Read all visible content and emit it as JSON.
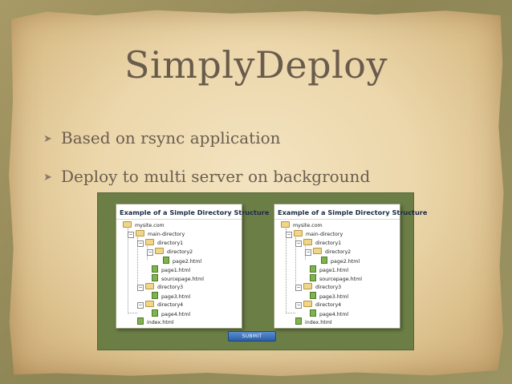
{
  "slide": {
    "title": "SimplyDeploy",
    "bullets": [
      {
        "icon": "arrow-bullet-icon",
        "text": "Based on rsync application"
      },
      {
        "icon": "arrow-bullet-icon",
        "text": "Deploy to multi server on background"
      }
    ]
  },
  "embedded_screenshot": {
    "panels": [
      {
        "title": "Example of a Simple Directory Structure",
        "tree": [
          "mysite.com",
          "main-directory",
          "directory1",
          "directory2",
          "page2.html",
          "page1.html",
          "sourcepage.html",
          "directory3",
          "page3.html",
          "directory4",
          "page4.html",
          "index.html"
        ]
      },
      {
        "title": "Example of a Simple Directory Structure",
        "tree": [
          "mysite.com",
          "main-directory",
          "directory1",
          "directory2",
          "page2.html",
          "page1.html",
          "sourcepage.html",
          "directory3",
          "page3.html",
          "directory4",
          "page4.html",
          "index.html"
        ]
      }
    ],
    "submit_label": "SUBMIT"
  },
  "colors": {
    "parchment": "#ecd7ab",
    "title_text": "#6a5c4d",
    "screenshot_bg": "#6b7e46",
    "submit_button": "#2c5fa6"
  }
}
